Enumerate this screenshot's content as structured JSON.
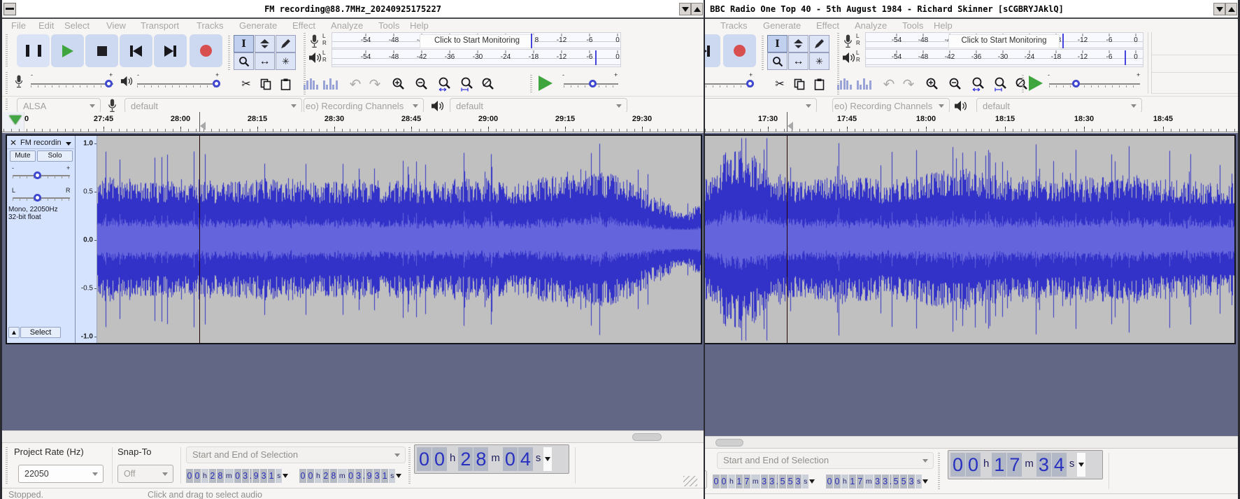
{
  "menubar": {
    "items": [
      "File",
      "Edit",
      "Select",
      "View",
      "Transport",
      "Tracks",
      "Generate",
      "Effect",
      "Analyze",
      "Tools",
      "Help"
    ]
  },
  "meter": {
    "scale": [
      "-54",
      "-48",
      "-42",
      "-36",
      "-30",
      "-24",
      "-18",
      "-12",
      "-6",
      "0"
    ],
    "monitor_text": "Click to Start Monitoring",
    "lr": [
      "L",
      "R"
    ]
  },
  "device": {
    "host": "ALSA",
    "input": "default",
    "channels": "eo) Recording Channels",
    "output": "default"
  },
  "colors": {
    "wave_dark": "#3232c8",
    "wave_light": "#6464dc",
    "wave_bg": "#c0c0c0",
    "panel": "#d5e3ff",
    "track_area": "#626785",
    "button_blue": "#cdd9f1",
    "record_red": "#d84f4f",
    "play_green": "#3fa63f"
  },
  "windows": [
    {
      "title": "FM recording@88.7MHz_20240925175227",
      "ruler": {
        "zero_label": "0",
        "labels": [
          "27:45",
          "28:00",
          "28:15",
          "28:30",
          "28:45",
          "29:00",
          "29:15",
          "29:30"
        ]
      },
      "track": {
        "name": "FM recordin",
        "mute": "Mute",
        "solo": "Solo",
        "gain_minus": "-",
        "gain_plus": "+",
        "pan_left": "L",
        "pan_right": "R",
        "info_line1": "Mono, 22050Hz",
        "info_line2": "32-bit float",
        "select_label": "Select",
        "scale": [
          "1.0",
          "0.5",
          "0.0",
          "-0.5",
          "-1.0"
        ]
      },
      "mixer": {
        "minus": "-",
        "plus": "+"
      },
      "selection_bar": {
        "rate_label": "Project Rate (Hz)",
        "rate": "22050",
        "snap_label": "Snap-To",
        "snap": "Off",
        "mode": "Start and End of Selection",
        "sel_start": "00 h 28 m 03.931 s",
        "sel_end": "00 h 28 m 03.931 s",
        "big_time": "00 h 28 m 04 s"
      },
      "status": {
        "state": "Stopped.",
        "hint": "Click and drag to select audio"
      },
      "waveform": {
        "seed": 7,
        "rms": 0.3,
        "envelope": [
          [
            0,
            0.58
          ],
          [
            0.02,
            0.63
          ],
          [
            0.08,
            0.56
          ],
          [
            0.15,
            0.6
          ],
          [
            0.22,
            0.57
          ],
          [
            0.3,
            0.61
          ],
          [
            0.38,
            0.56
          ],
          [
            0.45,
            0.6
          ],
          [
            0.52,
            0.56
          ],
          [
            0.6,
            0.6
          ],
          [
            0.68,
            0.57
          ],
          [
            0.75,
            0.62
          ],
          [
            0.8,
            0.7
          ],
          [
            0.85,
            0.66
          ],
          [
            0.9,
            0.52
          ],
          [
            0.94,
            0.38
          ],
          [
            0.97,
            0.3
          ],
          [
            1,
            0.34
          ]
        ]
      }
    },
    {
      "title": "BBC Radio One Top 40 - 5th August 1984 - Richard Skinner [sCGBRYJAklQ]",
      "ruler": {
        "zero_label": "",
        "labels": [
          "17:30",
          "17:45",
          "18:00",
          "18:15",
          "18:30",
          "18:45"
        ]
      },
      "track": {
        "name": "",
        "mute": "",
        "solo": "",
        "gain_minus": "",
        "gain_plus": "",
        "pan_left": "",
        "pan_right": "",
        "info_line1": "",
        "info_line2": "",
        "select_label": "",
        "scale": []
      },
      "mixer": {
        "minus": "-",
        "plus": "+"
      },
      "selection_bar": {
        "rate_label": "",
        "rate": "",
        "snap_label": "",
        "snap": "",
        "mode": "Start and End of Selection",
        "sel_start": "00 h 17 m 33.553 s",
        "sel_end": "00 h 17 m 33.553 s",
        "big_time": "00 h 17 m 34 s"
      },
      "status": {
        "state": "",
        "hint": ""
      },
      "waveform": {
        "seed": 23,
        "rms": 0.3,
        "envelope": [
          [
            0,
            0.55
          ],
          [
            0.1,
            0.56
          ],
          [
            0.13,
            0.6
          ],
          [
            0.16,
            0.9
          ],
          [
            0.2,
            0.84
          ],
          [
            0.24,
            0.62
          ],
          [
            0.3,
            0.58
          ],
          [
            0.35,
            0.64
          ],
          [
            0.42,
            0.58
          ],
          [
            0.5,
            0.66
          ],
          [
            0.55,
            0.72
          ],
          [
            0.6,
            0.63
          ],
          [
            0.68,
            0.62
          ],
          [
            0.75,
            0.6
          ],
          [
            0.82,
            0.64
          ],
          [
            0.9,
            0.58
          ],
          [
            1,
            0.55
          ]
        ]
      }
    }
  ]
}
